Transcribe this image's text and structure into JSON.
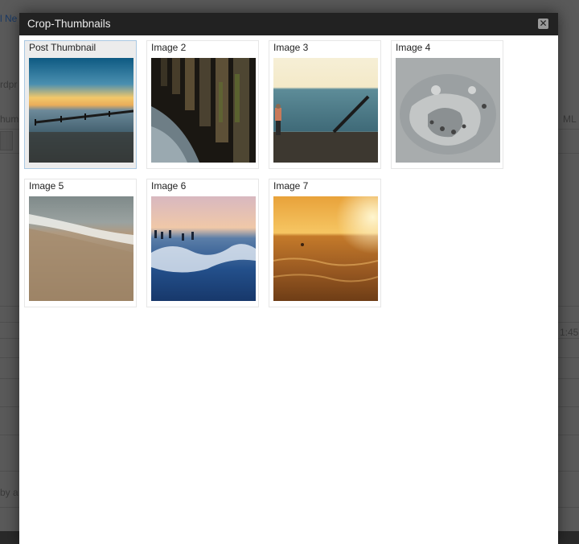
{
  "modal": {
    "title": "Crop-Thumbnails",
    "close_symbol": "✕"
  },
  "thumbnails": [
    {
      "label": "Post Thumbnail",
      "selected": true
    },
    {
      "label": "Image 2",
      "selected": false
    },
    {
      "label": "Image 3",
      "selected": false
    },
    {
      "label": "Image 4",
      "selected": false
    },
    {
      "label": "Image 5",
      "selected": false
    },
    {
      "label": "Image 6",
      "selected": false
    },
    {
      "label": "Image 7",
      "selected": false
    }
  ],
  "background_page": {
    "fragments": [
      "l Ne",
      "rdpr",
      "hum",
      "ML",
      "1:45",
      "by a"
    ]
  },
  "colors": {
    "overlay": "#2a2a2a",
    "titlebar": "#222222",
    "selected_border": "#a9c8e2"
  }
}
